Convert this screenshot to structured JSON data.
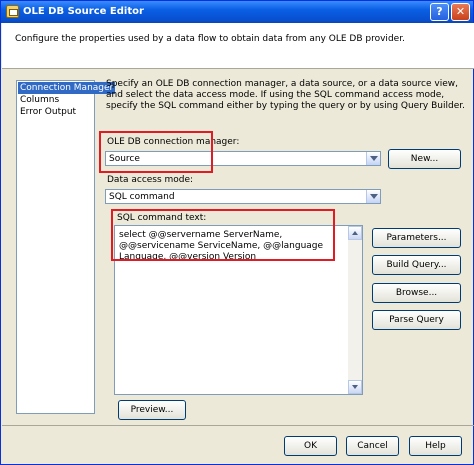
{
  "window": {
    "title": "OLE DB Source Editor",
    "help_glyph": "?",
    "close_glyph": "✕"
  },
  "header": {
    "description": "Configure the properties used by a data flow to obtain data from any OLE DB provider."
  },
  "nav": {
    "items": [
      {
        "label": "Connection Manager",
        "selected": true
      },
      {
        "label": "Columns",
        "selected": false
      },
      {
        "label": "Error Output",
        "selected": false
      }
    ]
  },
  "main": {
    "intro": "Specify an OLE DB connection manager, a data source, or a data source view, and select the data access mode. If using the SQL command access mode, specify the SQL command either by typing the query or by using Query Builder.",
    "connection_manager_label": "OLE DB connection manager:",
    "connection_manager_value": "Source",
    "new_button": "New...",
    "access_mode_label": "Data access mode:",
    "access_mode_value": "SQL command",
    "sql_label": "SQL command text:",
    "sql_text": "select @@servername ServerName, @@servicename ServiceName, @@language Language, @@version Version",
    "parameters_button": "Parameters...",
    "build_query_button": "Build Query...",
    "browse_button": "Browse...",
    "parse_query_button": "Parse Query",
    "preview_button": "Preview..."
  },
  "footer": {
    "ok_button": "OK",
    "cancel_button": "Cancel",
    "help_button": "Help"
  },
  "colors": {
    "highlight": "#e01b24",
    "selected_nav": "#316ac5",
    "titlebar": "#0a5fe4"
  }
}
